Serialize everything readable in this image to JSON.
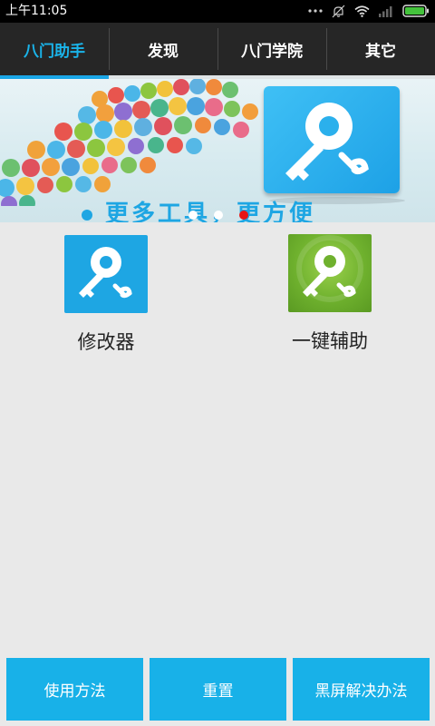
{
  "status_bar": {
    "time": "上午11:05",
    "icons": [
      "more-dots-icon",
      "notifications-off-icon",
      "wifi-icon",
      "signal-icon",
      "battery-icon"
    ]
  },
  "tabs": [
    {
      "label": "八门助手",
      "active": true
    },
    {
      "label": "发现",
      "active": false
    },
    {
      "label": "八门学院",
      "active": false
    },
    {
      "label": "其它",
      "active": false
    }
  ],
  "banner": {
    "slogan": "更多工具，更方便",
    "page_count": 3,
    "active_page": 3
  },
  "tools": [
    {
      "label": "修改器",
      "icon": "key-wrench-icon",
      "color": "#1ea6e3"
    },
    {
      "label": "一键辅助",
      "icon": "key-wrench-icon",
      "color": "#6fb12e"
    }
  ],
  "bottom_buttons": {
    "usage": "使用方法",
    "reset": "重置",
    "blackscreen_fix": "黑屏解决办法"
  },
  "colors": {
    "accent": "#1ab4ea",
    "tab_bar": "#262626",
    "pager_active": "#e61515",
    "background": "#e9e9e9"
  }
}
